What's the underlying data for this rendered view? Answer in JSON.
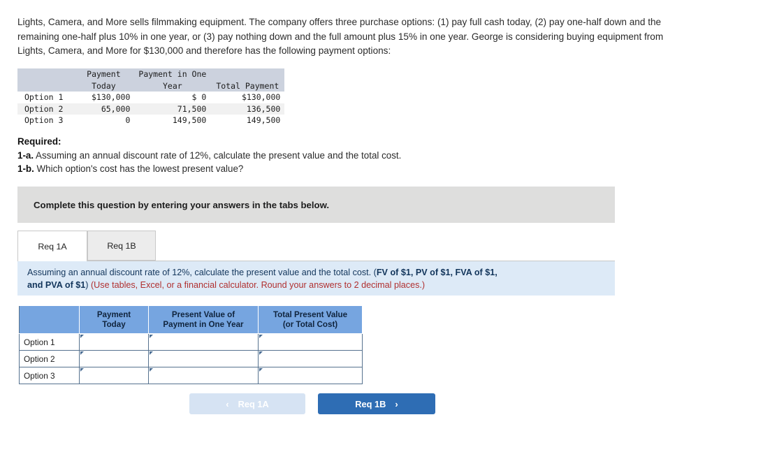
{
  "intro": {
    "paragraph": "Lights, Camera, and More sells filmmaking equipment. The company offers three purchase options: (1) pay full cash today, (2) pay one-half down and the remaining one-half plus 10% in one year, or (3) pay nothing down and the full amount plus 15% in one year. George is considering buying equipment from Lights, Camera, and More for $130,000 and therefore has the following payment options:"
  },
  "given_table": {
    "headers": {
      "blank": "",
      "col1_line1": "Payment",
      "col1_line2": "Today",
      "col2_line1": "Payment in One",
      "col2_line2": "Year",
      "col3_line1": "",
      "col3_line2": "Total Payment"
    },
    "rows": [
      {
        "label": "Option 1",
        "payment_today": "$130,000",
        "payment_one_year": "$ 0",
        "total_payment": "$130,000"
      },
      {
        "label": "Option 2",
        "payment_today": "65,000",
        "payment_one_year": "71,500",
        "total_payment": "136,500"
      },
      {
        "label": "Option 3",
        "payment_today": "0",
        "payment_one_year": "149,500",
        "total_payment": "149,500"
      }
    ]
  },
  "required": {
    "heading": "Required:",
    "item_1a_label": "1-a.",
    "item_1a_text": " Assuming an annual discount rate of 12%, calculate the present value and the total cost.",
    "item_1b_label": "1-b.",
    "item_1b_text": " Which option's cost has the lowest present value?"
  },
  "banner": {
    "text": "Complete this question by entering your answers in the tabs below."
  },
  "tabs": [
    {
      "label": "Req 1A",
      "active": true
    },
    {
      "label": "Req 1B",
      "active": false
    }
  ],
  "req_panel": {
    "line1_plain": "Assuming an annual discount rate of 12%, calculate the present value and the total cost. (",
    "line1_bold": "FV of $1, PV of $1, FVA of $1,",
    "line2_bold": "and PVA of $1",
    "line2_close": ") ",
    "line2_red": "(Use tables, Excel, or a financial calculator. Round your answers to 2 decimal places.)"
  },
  "answer_table": {
    "headers": {
      "corner": "",
      "col1_line1": "Payment",
      "col1_line2": "Today",
      "col2_line1": "Present Value of",
      "col2_line2": "Payment in One Year",
      "col3_line1": "Total Present Value",
      "col3_line2": "(or Total Cost)"
    },
    "rows": [
      {
        "label": "Option 1",
        "payment_today": "",
        "pv_payment_one_year": "",
        "total_pv": ""
      },
      {
        "label": "Option 2",
        "payment_today": "",
        "pv_payment_one_year": "",
        "total_pv": ""
      },
      {
        "label": "Option 3",
        "payment_today": "",
        "pv_payment_one_year": "",
        "total_pv": ""
      }
    ]
  },
  "footer": {
    "prev_label": "Req 1A",
    "prev_icon": "chevron-left-icon",
    "prev_chevron": "‹",
    "next_label": "Req 1B",
    "next_icon": "chevron-right-icon",
    "next_chevron": "›"
  },
  "colors": {
    "banner_grey": "#dededd",
    "panel_blue": "#ddeaf7",
    "table_header_blue": "#76a5e0",
    "given_header_grey": "#ccd2de",
    "next_button_blue": "#2e6db4",
    "prev_button_blue": "#d6e3f3",
    "red_note": "#b03030",
    "navy_text": "#12355b"
  }
}
